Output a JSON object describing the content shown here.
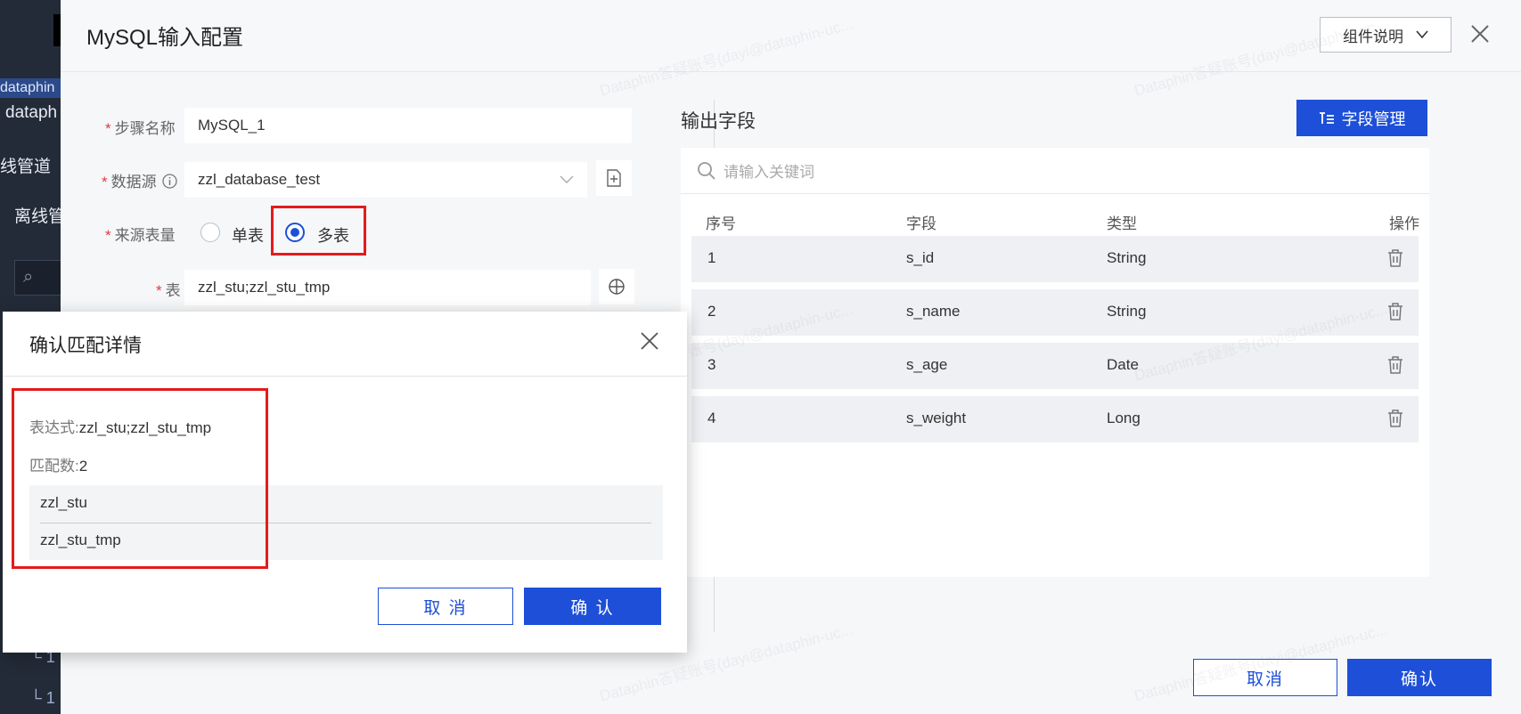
{
  "background": {
    "highlight_text": "dataphin",
    "items": [
      "dataph",
      "线管道",
      "离线管"
    ],
    "tree_items": [
      "1",
      "1"
    ]
  },
  "panel": {
    "title": "MySQL输入配置",
    "doc_button": "组件说明"
  },
  "form": {
    "step_name": {
      "label": "步骤名称",
      "value": "MySQL_1"
    },
    "datasource": {
      "label": "数据源",
      "value": "zzl_database_test"
    },
    "source_table_count": {
      "label": "来源表量",
      "options": [
        "单表",
        "多表"
      ],
      "selected": "多表"
    },
    "table": {
      "label": "表",
      "value": "zzl_stu;zzl_stu_tmp"
    }
  },
  "output": {
    "title": "输出字段",
    "field_manage_button": "字段管理",
    "search_placeholder": "请输入关键词",
    "columns": [
      "序号",
      "字段",
      "类型",
      "操作"
    ],
    "rows": [
      {
        "index": "1",
        "field": "s_id",
        "type": "String"
      },
      {
        "index": "2",
        "field": "s_name",
        "type": "String"
      },
      {
        "index": "3",
        "field": "s_age",
        "type": "Date"
      },
      {
        "index": "4",
        "field": "s_weight",
        "type": "Long"
      }
    ]
  },
  "footer": {
    "cancel": "取消",
    "confirm": "确认"
  },
  "dialog": {
    "title": "确认匹配详情",
    "expression_label": "表达式:",
    "expression_value": "zzl_stu;zzl_stu_tmp",
    "match_count_label": "匹配数:",
    "match_count_value": "2",
    "matches": [
      "zzl_stu",
      "zzl_stu_tmp"
    ],
    "cancel": "取 消",
    "confirm": "确 认"
  },
  "watermark": "Dataphin答疑账号(dayi@dataphin-uc...",
  "colors": {
    "primary": "#1d4fd8",
    "highlight": "#e41b1b",
    "required": "#e4393c"
  }
}
